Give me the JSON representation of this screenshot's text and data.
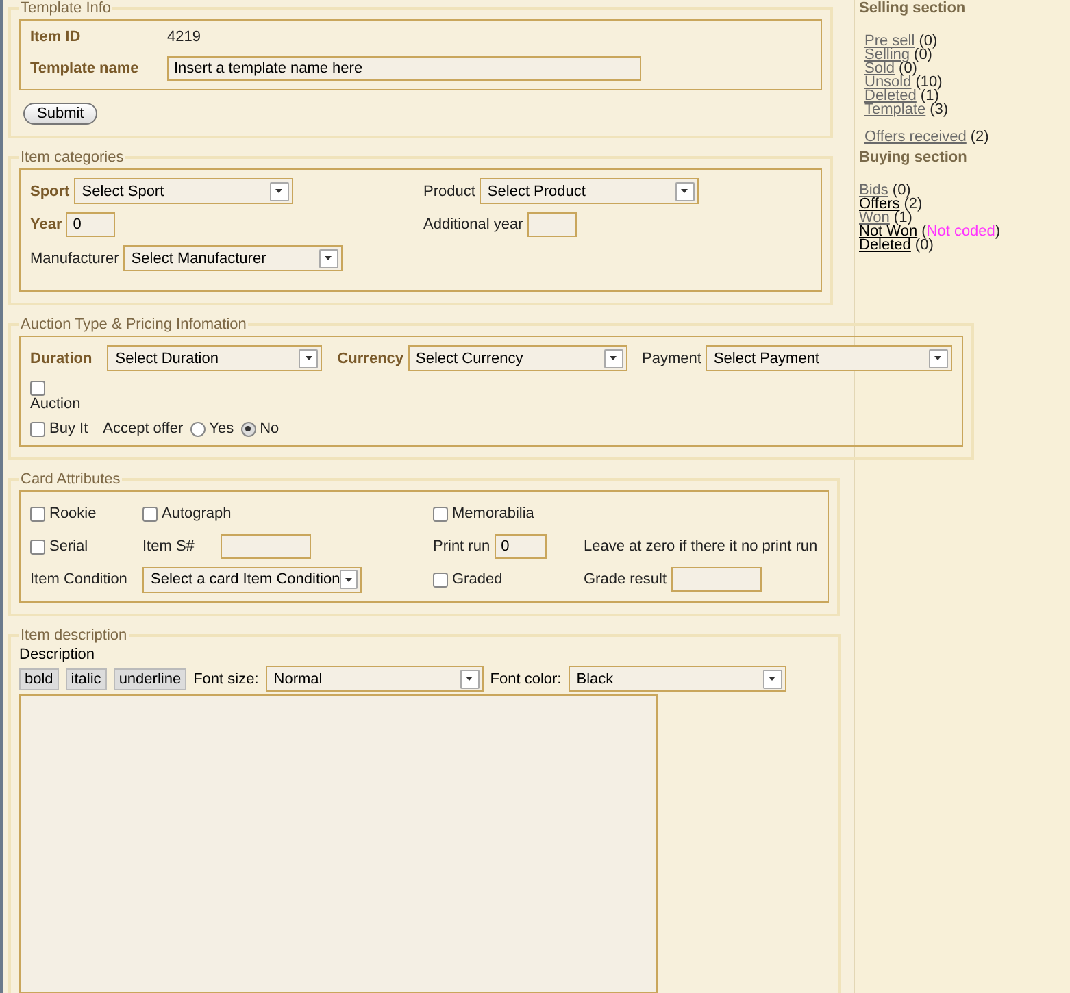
{
  "template_info": {
    "legend": "Template Info",
    "item_id_label": "Item ID",
    "item_id": "4219",
    "name_label": "Template name",
    "name_value": "Insert a template name here",
    "submit": "Submit"
  },
  "item_categories": {
    "legend": "Item categories",
    "sport_label": "Sport",
    "sport": "Select Sport",
    "product_label": "Product",
    "product": "Select Product",
    "year_label": "Year",
    "year": "0",
    "additional_year_label": "Additional year",
    "manufacturer_label": "Manufacturer",
    "manufacturer": "Select Manufacturer"
  },
  "auction": {
    "legend": "Auction Type & Pricing Infomation",
    "duration_label": "Duration",
    "duration": "Select Duration",
    "currency_label": "Currency",
    "currency": "Select Currency",
    "payment_label": "Payment",
    "payment": "Select Payment",
    "auction": {
      "label": "Auction",
      "checked": false
    },
    "buy_it": {
      "label": "Buy It",
      "checked": false
    },
    "accept_offer_label": "Accept offer",
    "accept_options": [
      {
        "label": "Yes",
        "selected": false
      },
      {
        "label": "No",
        "selected": true
      }
    ]
  },
  "card_attributes": {
    "legend": "Card Attributes",
    "rookie": {
      "label": "Rookie",
      "checked": false
    },
    "autograph": {
      "label": "Autograph",
      "checked": false
    },
    "memorabilia": {
      "label": "Memorabilia",
      "checked": false
    },
    "serial": {
      "label": "Serial",
      "checked": false
    },
    "item_serial_label": "Item S#",
    "print_run_label": "Print run",
    "print_run": "0",
    "print_run_hint": "Leave at zero if there it no print run",
    "condition_label": "Item Condition",
    "condition": "Select a card Item Condition",
    "graded": {
      "label": "Graded",
      "checked": false
    },
    "grade_result_label": "Grade result"
  },
  "item_description": {
    "legend": "Item description",
    "description_label": "Description",
    "format_buttons": [
      "bold",
      "italic",
      "underline"
    ],
    "font_size_label": "Font size:",
    "font_size": "Normal",
    "font_color_label": "Font color:",
    "font_color": "Black"
  },
  "sidebar": {
    "selling_heading": "Selling section",
    "selling_links": [
      {
        "label": "Pre sell",
        "count": "(0)",
        "visited": true
      },
      {
        "label": "Selling",
        "count": "(0)",
        "visited": true
      },
      {
        "label": "Sold",
        "count": "(0)",
        "visited": true
      },
      {
        "label": "Unsold",
        "count": "(10)",
        "visited": true
      },
      {
        "label": "Deleted",
        "count": "(1)",
        "visited": true
      },
      {
        "label": "Template",
        "count": "(3)",
        "visited": true
      }
    ],
    "offers_received": {
      "label": "Offers received",
      "count": "(2)",
      "visited": true
    },
    "buying_heading": "Buying section",
    "buying_links": [
      {
        "label": "Bids",
        "count": "(0)",
        "visited": true
      },
      {
        "label": "Offers",
        "count": "(2)",
        "visited": false
      },
      {
        "label": "Won",
        "count": "(1)",
        "visited": true
      },
      {
        "label": "Not Won",
        "open": "(",
        "note": "Not coded",
        "color": "#ff33ff",
        "close": ")",
        "visited": false
      },
      {
        "label": "Deleted",
        "count": "(0)",
        "visited": false
      }
    ]
  }
}
